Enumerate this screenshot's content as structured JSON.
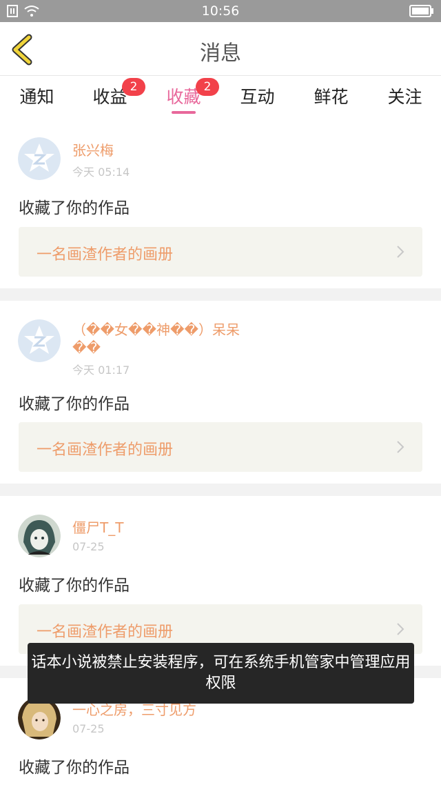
{
  "status_bar": {
    "time": "10:56"
  },
  "header": {
    "title": "消息"
  },
  "tabs": [
    {
      "label": "通知",
      "badge": ""
    },
    {
      "label": "收益",
      "badge": "2"
    },
    {
      "label": "收藏",
      "badge": "2"
    },
    {
      "label": "互动",
      "badge": ""
    },
    {
      "label": "鲜花",
      "badge": ""
    },
    {
      "label": "关注",
      "badge": ""
    }
  ],
  "active_tab": "收藏",
  "items": [
    {
      "author": "张兴梅",
      "date": "今天 05:14",
      "message": "收藏了你的作品",
      "album": "一名画渣作者的画册",
      "avatar": "default-qq-avatar"
    },
    {
      "author": "（��女��神��）呆呆��",
      "date": "今天 01:17",
      "message": "收藏了你的作品",
      "album": "一名画渣作者的画册",
      "avatar": "default-qq-avatar"
    },
    {
      "author": "僵尸T_T",
      "date": "07-25",
      "message": "收藏了你的作品",
      "album": "一名画渣作者的画册",
      "avatar": "anime-girl-avatar"
    },
    {
      "author": "一心之房，三寸见方",
      "date": "07-25",
      "message": "收藏了你的作品",
      "album": "",
      "avatar": "photo-avatar"
    }
  ],
  "toast": {
    "text": "话本小说被禁止安装程序，可在系统手机管家中管理应用权限"
  },
  "colors": {
    "accent": "#e8689b",
    "author": "#ee9c6a",
    "badge": "#f2414a",
    "back_arrow": "#f0d43a"
  }
}
